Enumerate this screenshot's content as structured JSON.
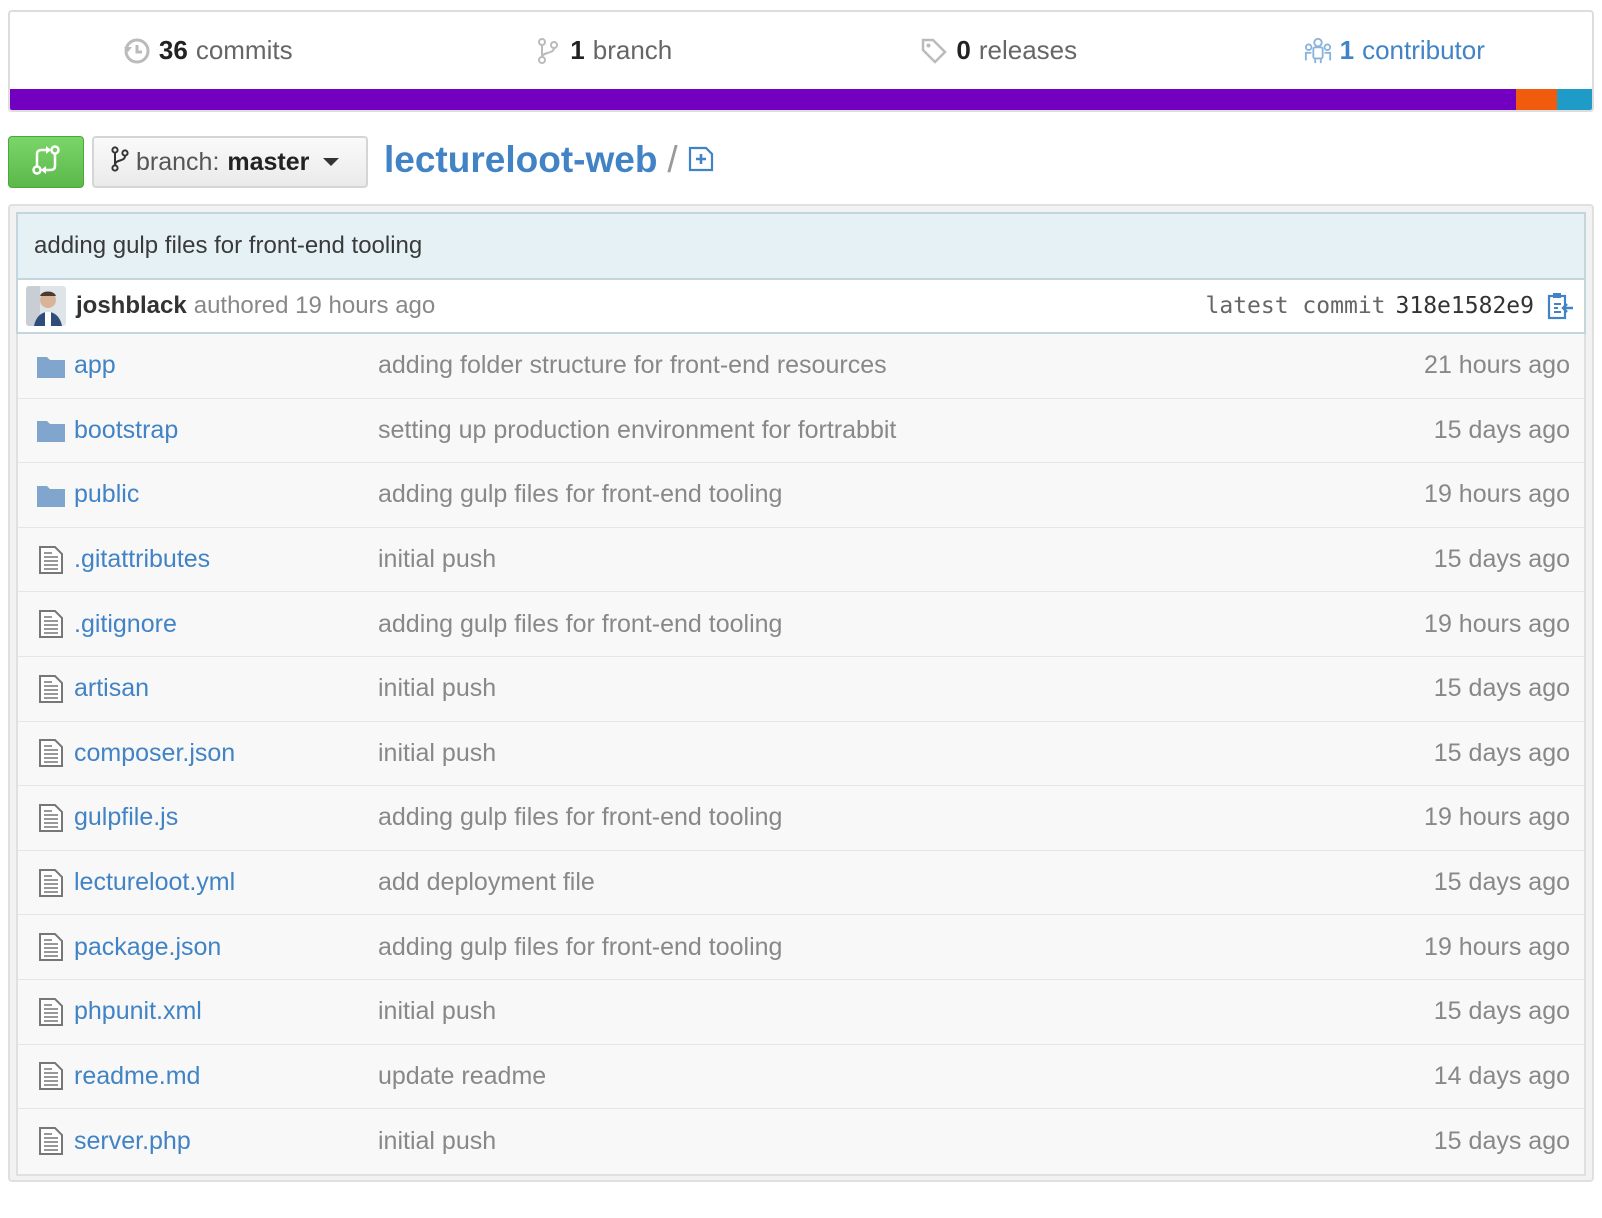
{
  "summary": {
    "commits": {
      "count": "36",
      "label": "commits",
      "icon": "history-icon"
    },
    "branches": {
      "count": "1",
      "label": "branch",
      "icon": "git-branch-icon"
    },
    "releases": {
      "count": "0",
      "label": "releases",
      "icon": "tag-icon"
    },
    "contributors": {
      "count": "1",
      "label": "contributor",
      "icon": "organization-icon"
    },
    "language_colors": [
      "#7300c1",
      "#f15b0e",
      "#1f9bc8"
    ],
    "language_fractions": [
      0.952,
      0.026,
      0.022
    ]
  },
  "filenav": {
    "compare_icon": "git-compare-icon",
    "branch_prefix": "branch:",
    "branch_name": "master",
    "repo_name": "lectureloot-web",
    "separator": "/",
    "new_file_icon": "file-add-icon"
  },
  "commit": {
    "message": "adding gulp files for front-end tooling",
    "author": "joshblack",
    "authored": "authored 19 hours ago",
    "latest_label": "latest commit",
    "sha": "318e1582e9",
    "copy_icon": "clippy-icon"
  },
  "files": [
    {
      "type": "dir",
      "name": "app",
      "message": "adding folder structure for front-end resources",
      "age": "21 hours ago"
    },
    {
      "type": "dir",
      "name": "bootstrap",
      "message": "setting up production environment for fortrabbit",
      "age": "15 days ago"
    },
    {
      "type": "dir",
      "name": "public",
      "message": "adding gulp files for front-end tooling",
      "age": "19 hours ago"
    },
    {
      "type": "file",
      "name": ".gitattributes",
      "message": "initial push",
      "age": "15 days ago"
    },
    {
      "type": "file",
      "name": ".gitignore",
      "message": "adding gulp files for front-end tooling",
      "age": "19 hours ago"
    },
    {
      "type": "file",
      "name": "artisan",
      "message": "initial push",
      "age": "15 days ago"
    },
    {
      "type": "file",
      "name": "composer.json",
      "message": "initial push",
      "age": "15 days ago"
    },
    {
      "type": "file",
      "name": "gulpfile.js",
      "message": "adding gulp files for front-end tooling",
      "age": "19 hours ago"
    },
    {
      "type": "file",
      "name": "lectureloot.yml",
      "message": "add deployment file",
      "age": "15 days ago"
    },
    {
      "type": "file",
      "name": "package.json",
      "message": "adding gulp files for front-end tooling",
      "age": "19 hours ago"
    },
    {
      "type": "file",
      "name": "phpunit.xml",
      "message": "initial push",
      "age": "15 days ago"
    },
    {
      "type": "file",
      "name": "readme.md",
      "message": "update readme",
      "age": "14 days ago"
    },
    {
      "type": "file",
      "name": "server.php",
      "message": "initial push",
      "age": "15 days ago"
    }
  ]
}
